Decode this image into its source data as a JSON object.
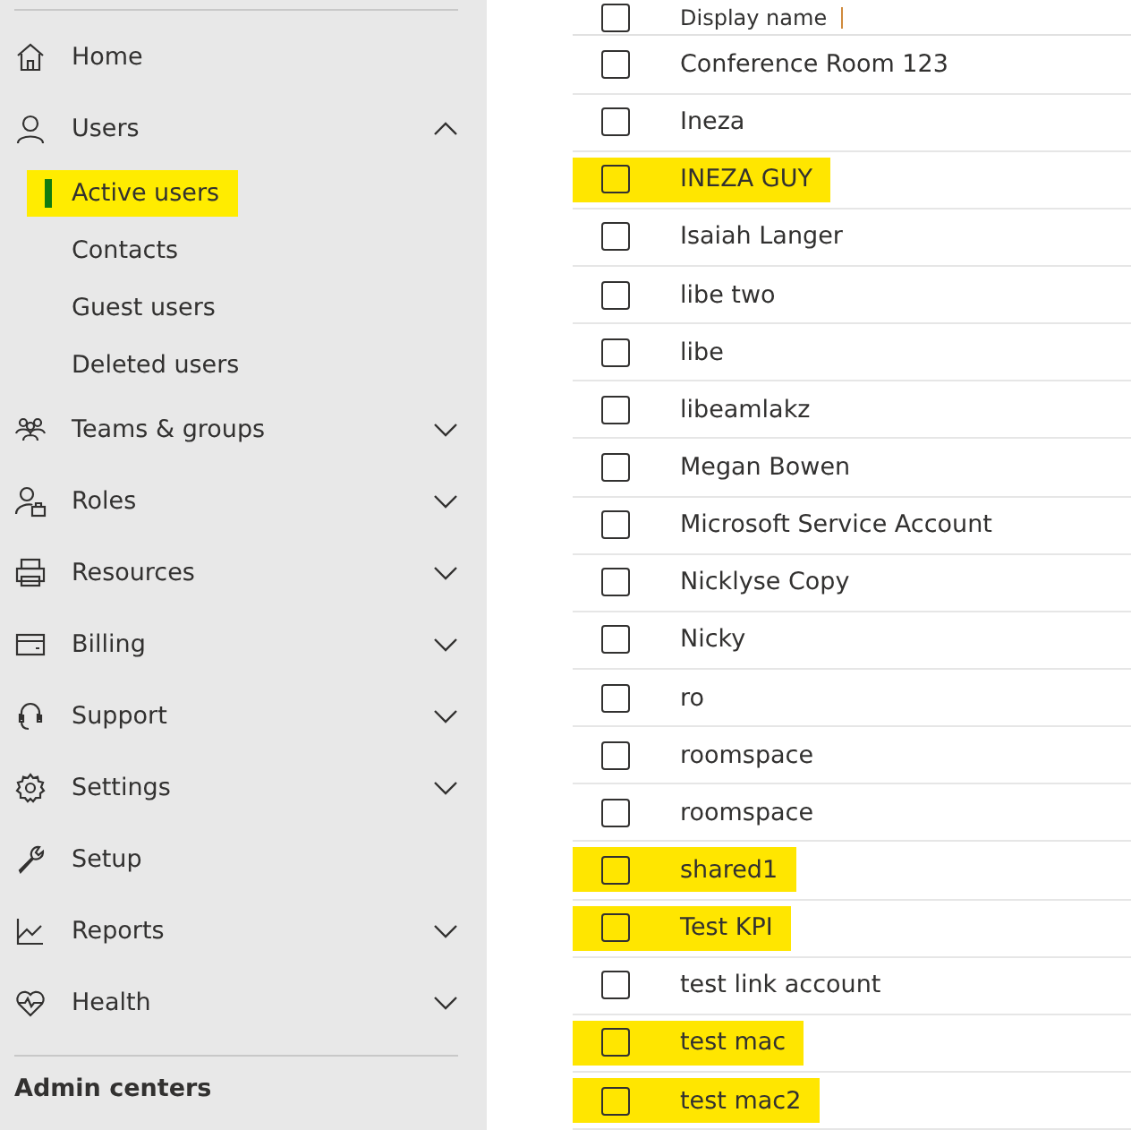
{
  "sidebar": {
    "items": [
      {
        "label": "Home"
      },
      {
        "label": "Users",
        "expanded": true,
        "children": [
          {
            "label": "Active users",
            "selected": true,
            "highlighted": true
          },
          {
            "label": "Contacts",
            "selected": false,
            "highlighted": false
          },
          {
            "label": "Guest users",
            "selected": false,
            "highlighted": false
          },
          {
            "label": "Deleted users",
            "selected": false,
            "highlighted": false
          }
        ]
      },
      {
        "label": "Teams & groups",
        "expanded": false
      },
      {
        "label": "Roles",
        "expanded": false
      },
      {
        "label": "Resources",
        "expanded": false
      },
      {
        "label": "Billing",
        "expanded": false
      },
      {
        "label": "Support",
        "expanded": false
      },
      {
        "label": "Settings",
        "expanded": false
      },
      {
        "label": "Setup"
      },
      {
        "label": "Reports",
        "expanded": false
      },
      {
        "label": "Health",
        "expanded": false
      }
    ],
    "footer": "Admin centers"
  },
  "table": {
    "columns": [
      "Display name"
    ],
    "select_all_checked": false,
    "rows": [
      {
        "name": "Conference Room 123",
        "checked": false,
        "highlighted": false
      },
      {
        "name": "Ineza",
        "checked": false,
        "highlighted": false
      },
      {
        "name": "INEZA GUY",
        "checked": false,
        "highlighted": true
      },
      {
        "name": "Isaiah Langer",
        "checked": false,
        "highlighted": false
      },
      {
        "name": "libe two",
        "checked": false,
        "highlighted": false
      },
      {
        "name": "libe",
        "checked": false,
        "highlighted": false
      },
      {
        "name": "libeamlakz",
        "checked": false,
        "highlighted": false
      },
      {
        "name": "Megan Bowen",
        "checked": false,
        "highlighted": false
      },
      {
        "name": "Microsoft Service Account",
        "checked": false,
        "highlighted": false
      },
      {
        "name": "Nicklyse Copy",
        "checked": false,
        "highlighted": false
      },
      {
        "name": "Nicky",
        "checked": false,
        "highlighted": false
      },
      {
        "name": "ro",
        "checked": false,
        "highlighted": false
      },
      {
        "name": "roomspace",
        "checked": false,
        "highlighted": false
      },
      {
        "name": "roomspace",
        "checked": false,
        "highlighted": false
      },
      {
        "name": "shared1",
        "checked": false,
        "highlighted": true
      },
      {
        "name": "Test KPI",
        "checked": false,
        "highlighted": true
      },
      {
        "name": "test link account",
        "checked": false,
        "highlighted": false
      },
      {
        "name": "test mac",
        "checked": false,
        "highlighted": true
      },
      {
        "name": "test mac2",
        "checked": false,
        "highlighted": true
      }
    ]
  }
}
